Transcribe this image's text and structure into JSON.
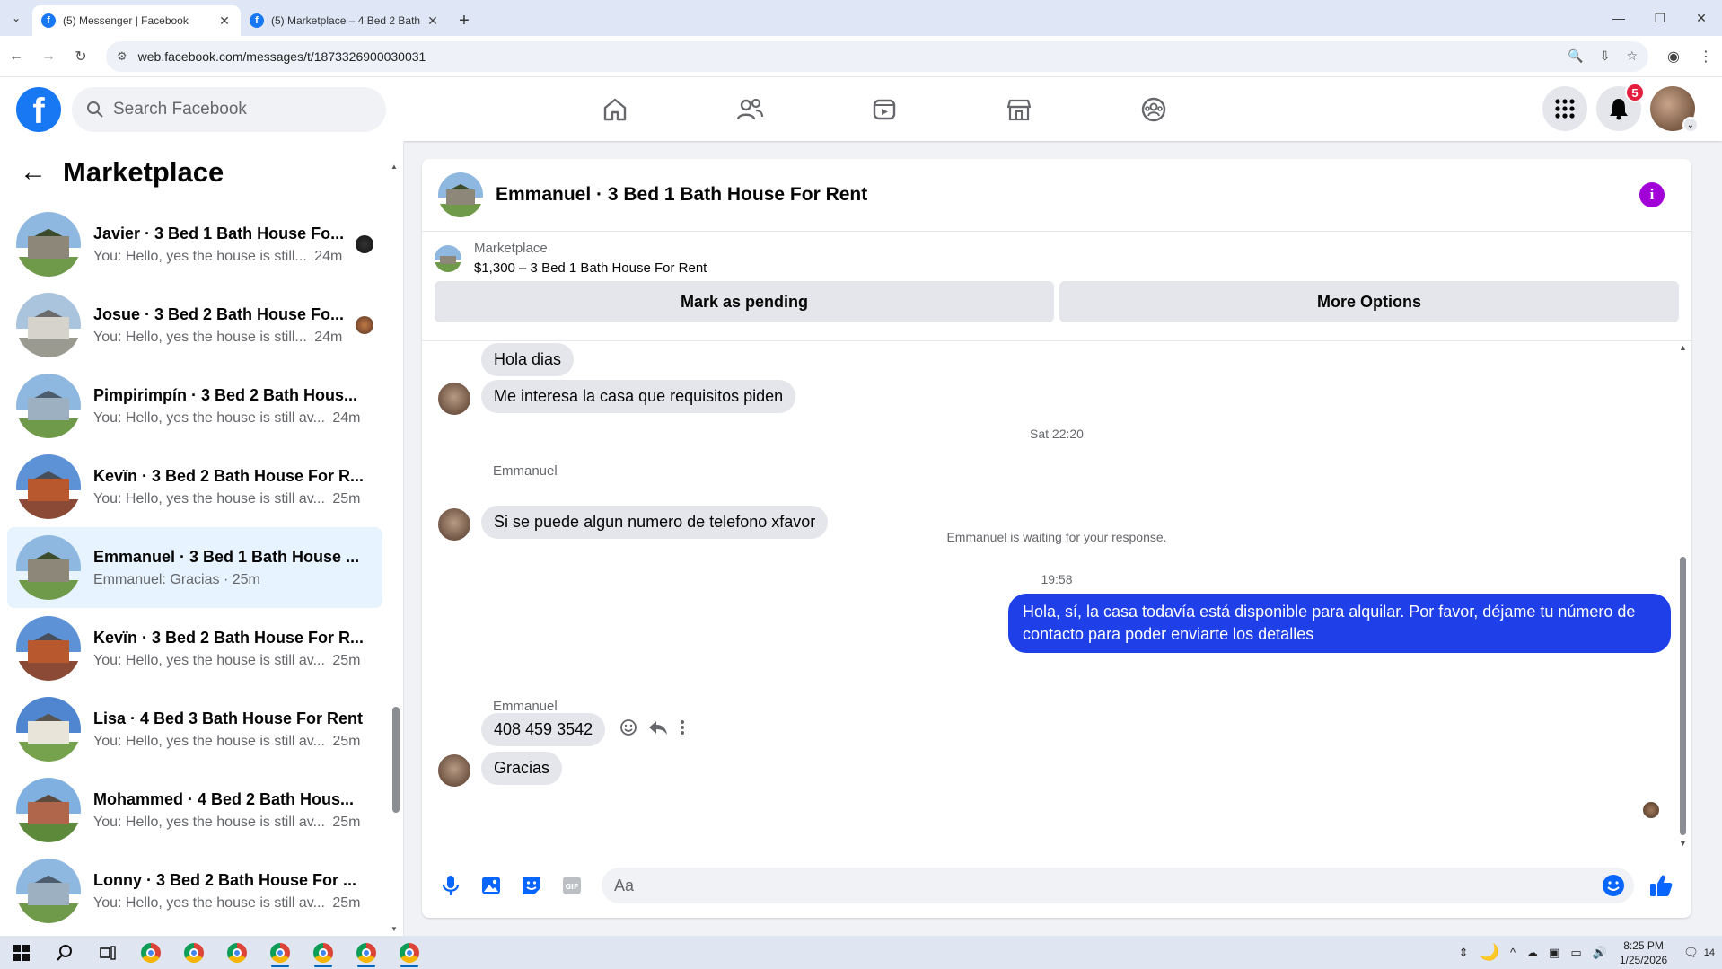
{
  "browser": {
    "tabs": [
      {
        "title": "(5) Messenger | Facebook",
        "active": true
      },
      {
        "title": "(5) Marketplace – 4 Bed 2 Bath",
        "active": false
      }
    ],
    "url": "web.facebook.com/messages/t/1873326900030031"
  },
  "fb": {
    "search_placeholder": "Search Facebook",
    "notification_count": "5"
  },
  "sidebar": {
    "title": "Marketplace",
    "conversations": [
      {
        "title": "Javier · 3 Bed 1 Bath House Fo...",
        "preview": "You: Hello, yes the house is still...",
        "time": "24m"
      },
      {
        "title": "Josue · 3 Bed 2 Bath House Fo...",
        "preview": "You: Hello, yes the house is still...",
        "time": "24m"
      },
      {
        "title": "Pimpirimpín · 3 Bed 2 Bath Hous...",
        "preview": "You: Hello, yes the house is still av...",
        "time": "24m"
      },
      {
        "title": "Kevïn · 3 Bed 2 Bath House For R...",
        "preview": "You: Hello, yes the house is still av...",
        "time": "25m"
      },
      {
        "title": "Emmanuel · 3 Bed 1 Bath House ...",
        "preview": "Emmanuel: Gracias · 25m",
        "time": ""
      },
      {
        "title": "Kevïn · 3 Bed 2 Bath House For R...",
        "preview": "You: Hello, yes the house is still av...",
        "time": "25m"
      },
      {
        "title": "Lisa · 4 Bed 3 Bath House For Rent",
        "preview": "You: Hello, yes the house is still av...",
        "time": "25m"
      },
      {
        "title": "Mohammed · 4 Bed 2 Bath Hous...",
        "preview": "You: Hello, yes the house is still av...",
        "time": "25m"
      },
      {
        "title": "Lonny · 3 Bed 2 Bath House For ...",
        "preview": "You: Hello, yes the house is still av...",
        "time": "25m"
      }
    ]
  },
  "chat": {
    "title": "Emmanuel · 3 Bed 1 Bath House For Rent",
    "marketplace_label": "Marketplace",
    "listing": "$1,300 – 3 Bed 1 Bath House For Rent",
    "mark_pending_label": "Mark as pending",
    "more_options_label": "More Options",
    "messages": {
      "m1": "Hola dias",
      "m2": "Me interesa la casa que requisitos piden",
      "time1": "Sat 22:20",
      "sender1": "Emmanuel",
      "m3": "Si se puede algun numero de telefono xfavor",
      "waiting": "Emmanuel is waiting for your response.",
      "time2": "19:58",
      "out1": "Hola, sí, la casa todavía está disponible para alquilar. Por favor, déjame tu número de contacto para poder enviarte los detalles",
      "sender2": "Emmanuel",
      "m4": "408 459 3542",
      "m5": "Gracias"
    },
    "composer_placeholder": "Aa"
  },
  "taskbar": {
    "time": "8:25 PM",
    "date": "1/25/2026",
    "notifications": "14"
  }
}
